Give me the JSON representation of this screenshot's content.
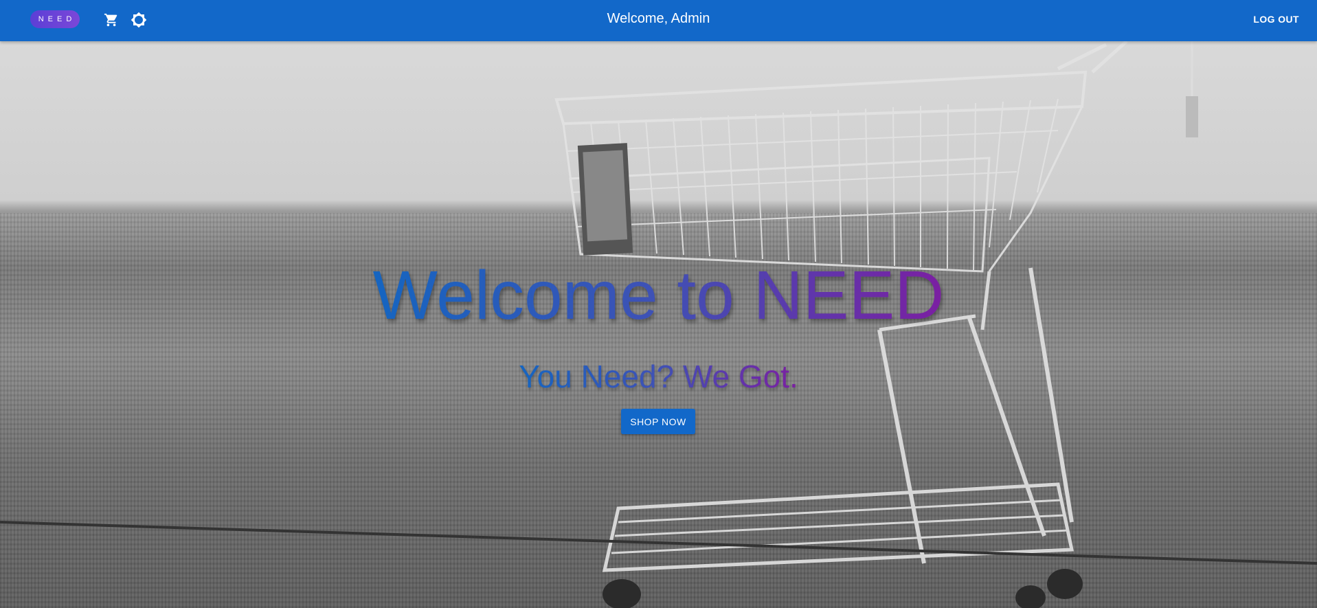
{
  "appbar": {
    "logo_text": "NEED",
    "title": "Welcome, Admin",
    "logout_label": "LOG OUT",
    "color": "#1268c9",
    "icons": [
      "cart-icon",
      "settings-icon"
    ]
  },
  "hero": {
    "title": "Welcome to NEED",
    "subtitle": "You Need? We Got.",
    "cta_label": "SHOP NOW",
    "gradient": [
      "#1565c0",
      "#3f51b5",
      "#7b1fa2"
    ]
  }
}
